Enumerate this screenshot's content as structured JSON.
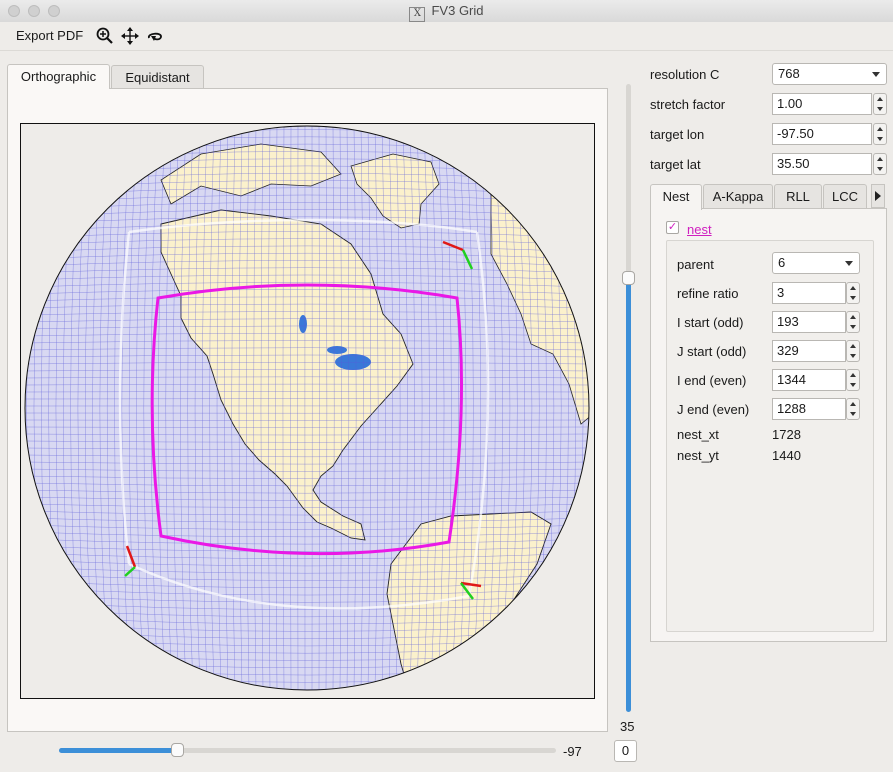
{
  "window": {
    "title": "FV3 Grid"
  },
  "toolbar": {
    "export_label": "Export PDF",
    "icons": [
      "zoom-in-icon",
      "pan-icon",
      "rotate-icon"
    ]
  },
  "view_tabs": [
    {
      "label": "Orthographic",
      "active": true
    },
    {
      "label": "Equidistant",
      "active": false
    }
  ],
  "map": {
    "colors": {
      "ocean": "#d8d8f2",
      "land": "#fbf1cc",
      "grid": "#5a5ad8",
      "nest": "#ea18e6",
      "axis_red": "#e01818",
      "axis_green": "#20d020",
      "lakes": "#3a78d8"
    }
  },
  "sliders": {
    "vertical_value": "35",
    "vertical_level": 0.69,
    "horizontal_value": "-97",
    "horizontal_level": 0.24,
    "reset_label": "0"
  },
  "params": {
    "resolution_label": "resolution C",
    "resolution_value": "768",
    "stretch_label": "stretch factor",
    "stretch_value": "1.00",
    "target_lon_label": "target lon",
    "target_lon_value": "-97.50",
    "target_lat_label": "target lat",
    "target_lat_value": "35.50"
  },
  "side_tabs": [
    {
      "label": "Nest",
      "active": true
    },
    {
      "label": "A-Kappa",
      "active": false
    },
    {
      "label": "RLL",
      "active": false
    },
    {
      "label": "LCC",
      "active": false
    }
  ],
  "nest": {
    "checkbox_label": "nest",
    "checked": true,
    "parent_label": "parent",
    "parent_value": "6",
    "refine_label": "refine ratio",
    "refine_value": "3",
    "istart_label": "I start (odd)",
    "istart_value": "193",
    "jstart_label": "J start (odd)",
    "jstart_value": "329",
    "iend_label": "I end (even)",
    "iend_value": "1344",
    "jend_label": "J end (even)",
    "jend_value": "1288",
    "xt_label": "nest_xt",
    "xt_value": "1728",
    "yt_label": "nest_yt",
    "yt_value": "1440"
  }
}
